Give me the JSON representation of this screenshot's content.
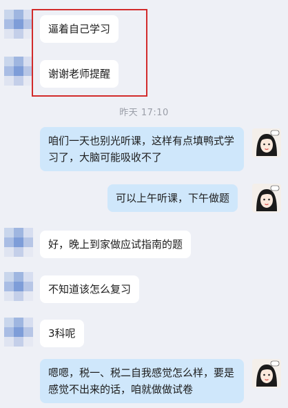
{
  "timestamp": "昨天 17:10",
  "messages": [
    {
      "text": "逼着自己学习"
    },
    {
      "text": "谢谢老师提醒"
    },
    {
      "text": "咱们一天也别光听课，这样有点填鸭式学习了，大脑可能吸收不了"
    },
    {
      "text": "可以上午听课，下午做题"
    },
    {
      "text": "好，晚上到家做应试指南的题"
    },
    {
      "text": "不知道该怎么复习"
    },
    {
      "text": "3科呢"
    },
    {
      "text": "嗯嗯，税一、税二自我感觉怎么样，要是感觉不出来的话，咱就做做试卷"
    }
  ],
  "colors": {
    "background": "#eef0f6",
    "incoming_bubble": "#ffffff",
    "outgoing_bubble": "#cfe7fb",
    "highlight_border": "#d22a2a"
  }
}
